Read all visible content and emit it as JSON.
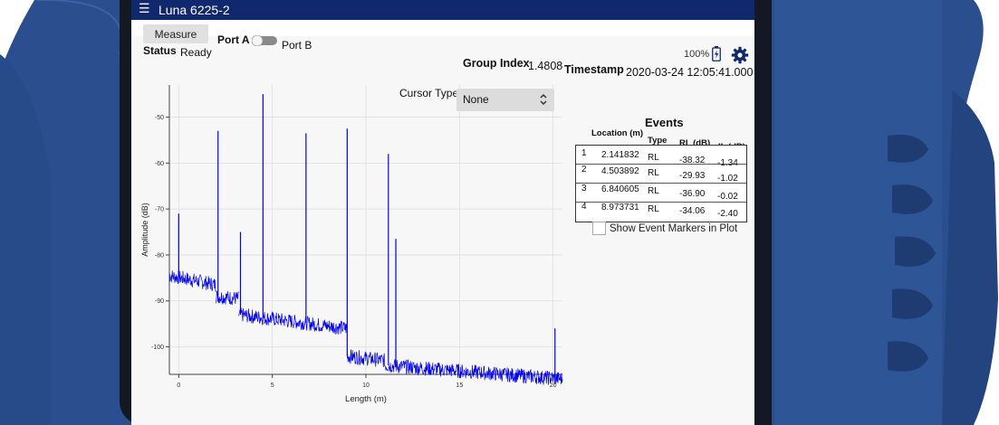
{
  "app": {
    "title": "Luna 6225-2",
    "menu_icon": "hamburger-menu-icon"
  },
  "status_bar": {
    "battery_text": "100%",
    "battery_icon": "battery-charging-icon",
    "settings_icon": "gear-icon"
  },
  "controls": {
    "measure_label": "Measure",
    "port_a_label": "Port A",
    "port_b_label": "Port B",
    "port_toggle_state": "Port A",
    "status_label": "Status",
    "status_value": "Ready"
  },
  "info": {
    "group_index_label": "Group Index",
    "group_index_value": "1.4808",
    "timestamp_label": "Timestamp",
    "timestamp_value": "2020-03-24 12:05:41.000"
  },
  "cursor": {
    "label": "Cursor Type",
    "value": "None"
  },
  "events": {
    "title": "Events",
    "columns": [
      "Location (m)",
      "Type",
      "RL (dB)",
      "IL (dB)"
    ],
    "rows": [
      {
        "index": "1",
        "location": "2.141832",
        "type": "RL",
        "rl": "-38.32",
        "il": "-1.34"
      },
      {
        "index": "2",
        "location": "4.503892",
        "type": "RL",
        "rl": "-29.93",
        "il": "-1.02"
      },
      {
        "index": "3",
        "location": "6.840605",
        "type": "RL",
        "rl": "-36.90",
        "il": "-0.02"
      },
      {
        "index": "4",
        "location": "8.973731",
        "type": "RL",
        "rl": "-34.06",
        "il": "-2.40"
      }
    ],
    "show_markers_label": "Show Event Markers in Plot",
    "show_markers_checked": false
  },
  "chart_data": {
    "type": "line",
    "xlabel": "Length (m)",
    "ylabel": "Amplitude (dB)",
    "xlim": [
      -0.5,
      20.5
    ],
    "ylim": [
      -106,
      -43
    ],
    "x_ticks": [
      "0",
      "5",
      "10",
      "15",
      "20"
    ],
    "x_tick_values": [
      0,
      5,
      10,
      15,
      20
    ],
    "y_ticks": [
      "-50",
      "-60",
      "-70",
      "-80",
      "-90",
      "-100"
    ],
    "y_tick_values": [
      -50,
      -60,
      -70,
      -80,
      -90,
      -100
    ],
    "grid": true,
    "series": [
      {
        "color": "#0000ee",
        "baseline_segments": [
          {
            "x": [
              -0.5,
              2.0
            ],
            "y": [
              -84.5,
              -86.5
            ]
          },
          {
            "x": [
              2.0,
              3.2
            ],
            "y": [
              -89,
              -89.5
            ]
          },
          {
            "x": [
              3.2,
              9.0
            ],
            "y": [
              -93,
              -96
            ]
          },
          {
            "x": [
              9.0,
              11.0
            ],
            "y": [
              -102,
              -103
            ]
          },
          {
            "x": [
              11.0,
              20.5
            ],
            "y": [
              -104,
              -107
            ]
          }
        ],
        "peaks": [
          {
            "x": 0.0,
            "y": -71
          },
          {
            "x": 2.1,
            "y": -53
          },
          {
            "x": 3.3,
            "y": -75
          },
          {
            "x": 4.5,
            "y": -45
          },
          {
            "x": 6.8,
            "y": -53.5
          },
          {
            "x": 9.0,
            "y": -52.5
          },
          {
            "x": 11.2,
            "y": -58
          },
          {
            "x": 11.6,
            "y": -76.5
          },
          {
            "x": 20.1,
            "y": -96
          }
        ]
      }
    ]
  }
}
